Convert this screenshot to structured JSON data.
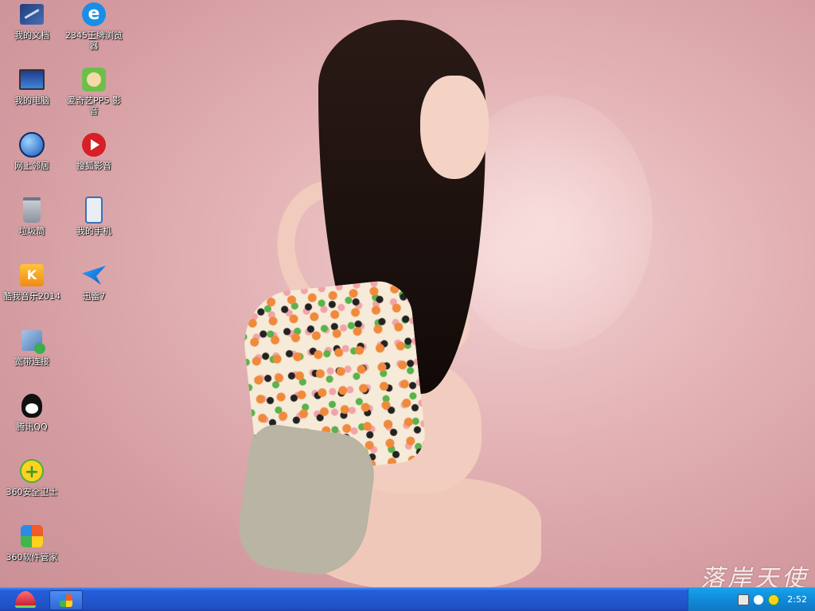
{
  "desktop": {
    "icons": [
      {
        "label": "我的文档",
        "icon": "my-documents-icon"
      },
      {
        "label": "2345王牌浏览器",
        "icon": "browser-2345-icon"
      },
      {
        "label": "我的电脑",
        "icon": "my-computer-icon"
      },
      {
        "label": "爱奇艺PPS 影音",
        "icon": "iqiyi-pps-icon"
      },
      {
        "label": "网上邻居",
        "icon": "network-places-icon"
      },
      {
        "label": "搜狐影音",
        "icon": "sohu-video-icon"
      },
      {
        "label": "垃圾筒",
        "icon": "recycle-bin-icon"
      },
      {
        "label": "我的手机",
        "icon": "my-phone-icon"
      },
      {
        "label": "酷我音乐2014",
        "icon": "kuwo-music-icon"
      },
      {
        "label": "迅雷7",
        "icon": "xunlei-icon"
      },
      {
        "label": "宽带连接",
        "icon": "broadband-connection-icon"
      },
      {
        "label": "腾讯QQ",
        "icon": "qq-icon"
      },
      {
        "label": "360安全卫士",
        "icon": "360-safe-icon"
      },
      {
        "label": "360软件管家",
        "icon": "360-software-manager-icon"
      }
    ]
  },
  "watermark": "落岸天使",
  "taskbar": {
    "start_icon": "watermelon-start-icon",
    "open_item_icon": "360-software-manager-icon",
    "clock": "2:52",
    "tray_icons": [
      "keyboard-icon",
      "ime-icon",
      "360-tray-icon"
    ]
  },
  "colors": {
    "taskbar": "#245edb",
    "tray": "#0f8bd9",
    "wallpaper": "#d9a5a8"
  }
}
